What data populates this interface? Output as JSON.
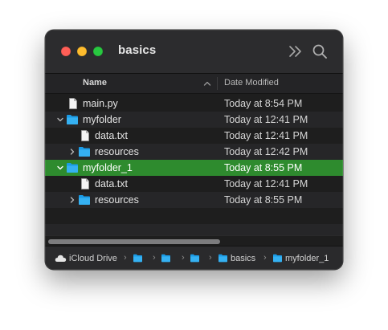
{
  "window": {
    "title": "basics",
    "traffic_lights": {
      "close": "#ff5f57",
      "minimize": "#febc2e",
      "zoom": "#28c840"
    },
    "toolbar_icons": [
      "chevron-more-icon",
      "search-icon"
    ]
  },
  "columns": {
    "name": "Name",
    "date_modified": "Date Modified"
  },
  "rows": [
    {
      "name": "main.py",
      "date": "Today at 8:54 PM",
      "type": "file",
      "indent": 0,
      "expanded": null,
      "selected": false
    },
    {
      "name": "myfolder",
      "date": "Today at 12:41 PM",
      "type": "folder",
      "indent": 0,
      "expanded": true,
      "selected": false
    },
    {
      "name": "data.txt",
      "date": "Today at 12:41 PM",
      "type": "file",
      "indent": 1,
      "expanded": null,
      "selected": false
    },
    {
      "name": "resources",
      "date": "Today at 12:42 PM",
      "type": "folder",
      "indent": 1,
      "expanded": false,
      "selected": false
    },
    {
      "name": "myfolder_1",
      "date": "Today at 8:55 PM",
      "type": "folder",
      "indent": 0,
      "expanded": true,
      "selected": true
    },
    {
      "name": "data.txt",
      "date": "Today at 12:41 PM",
      "type": "file",
      "indent": 1,
      "expanded": null,
      "selected": false
    },
    {
      "name": "resources",
      "date": "Today at 8:55 PM",
      "type": "folder",
      "indent": 1,
      "expanded": false,
      "selected": false
    }
  ],
  "selection_color": "#2e8b2e",
  "pathbar": {
    "items": [
      {
        "label": "iCloud Drive",
        "icon": "cloud-icon"
      },
      {
        "label": " ",
        "icon": "folder-icon"
      },
      {
        "label": " ",
        "icon": "folder-icon"
      },
      {
        "label": " ",
        "icon": "folder-icon"
      },
      {
        "label": "basics",
        "icon": "folder-icon"
      },
      {
        "label": "myfolder_1",
        "icon": "folder-icon"
      }
    ],
    "separator": "›"
  }
}
